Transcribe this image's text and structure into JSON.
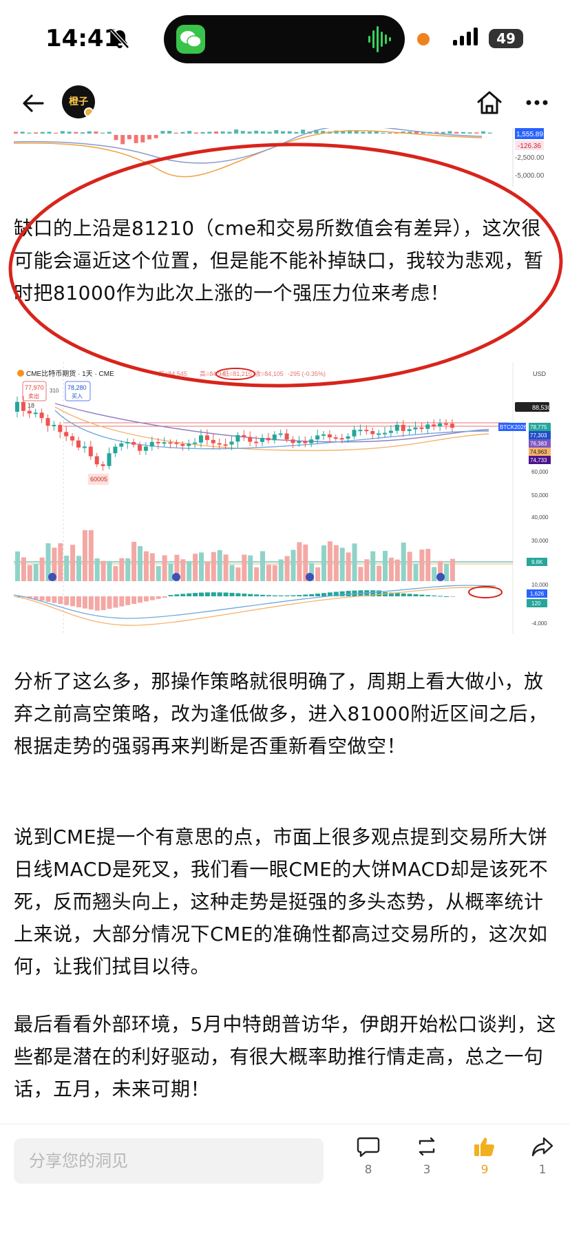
{
  "status": {
    "time": "14:41",
    "battery": "49"
  },
  "article": {
    "paragraphs": [
      "缺口的上沿是81210（cme和交易所数值会有差异），这次很可能会逼近这个位置，但是能不能补掉缺口，我较为悲观，暂时把81000作为此次上涨的一个强压力位来考虑！",
      "分析了这么多，那操作策略就很明确了，周期上看大做小，放弃之前高空策略，改为逢低做多，进入81000附近区间之后，根据走势的强弱再来判断是否重新看空做空！",
      "说到CME提一个有意思的点，市面上很多观点提到交易所大饼日线MACD是死叉，我们看一眼CME的大饼MACD却是该死不死，反而翘头向上，这种走势是挺强的多头态势，从概率统计上来说，大部分情况下CME的准确性都高过交易所的，这次如何，让我们拭目以待。",
      "最后看看外部环境，5月中特朗普访华，伊朗开始松口谈判，这些都是潜在的利好驱动，有很大概率助推行情走高，总之一句话，五月，未来可期！"
    ]
  },
  "chart_top": {
    "axis_labels": [
      "1,555.89",
      "-126.36",
      "-2,500.00",
      "-5,000.00"
    ]
  },
  "chart_main": {
    "title": "CME比特币期货 · 1天 · CME",
    "ohlc": {
      "open": "开=84,545",
      "high": "高=84,94",
      "low": "低=81,210",
      "close": "收=84,105",
      "change": "-295 (-0.35%)"
    },
    "currency": "USD",
    "sell_price": "77,970",
    "sell_label": "卖出",
    "spread": "310",
    "buy_price": "78,280",
    "buy_label": "买入",
    "indicator_count": "18",
    "top_price_tag": "88,530",
    "low_marker": "60005",
    "ticker_tag": "BTCK2026",
    "price_tags": [
      "78,775",
      "77,303",
      "76,383",
      "74,963",
      "74,733"
    ],
    "axis_labels": [
      "60,000",
      "50,000",
      "40,000",
      "30,000",
      "10,000",
      "-4,000"
    ],
    "volume_tag": "9.8K",
    "macd_tags": [
      "1,626",
      "120"
    ],
    "colors": {
      "up": "#26a69a",
      "down": "#ef5350",
      "highlight": "#e0231c"
    }
  },
  "bottom_bar": {
    "placeholder": "分享您的洞见",
    "comments": "8",
    "reposts": "3",
    "likes": "9",
    "shares": "1"
  }
}
